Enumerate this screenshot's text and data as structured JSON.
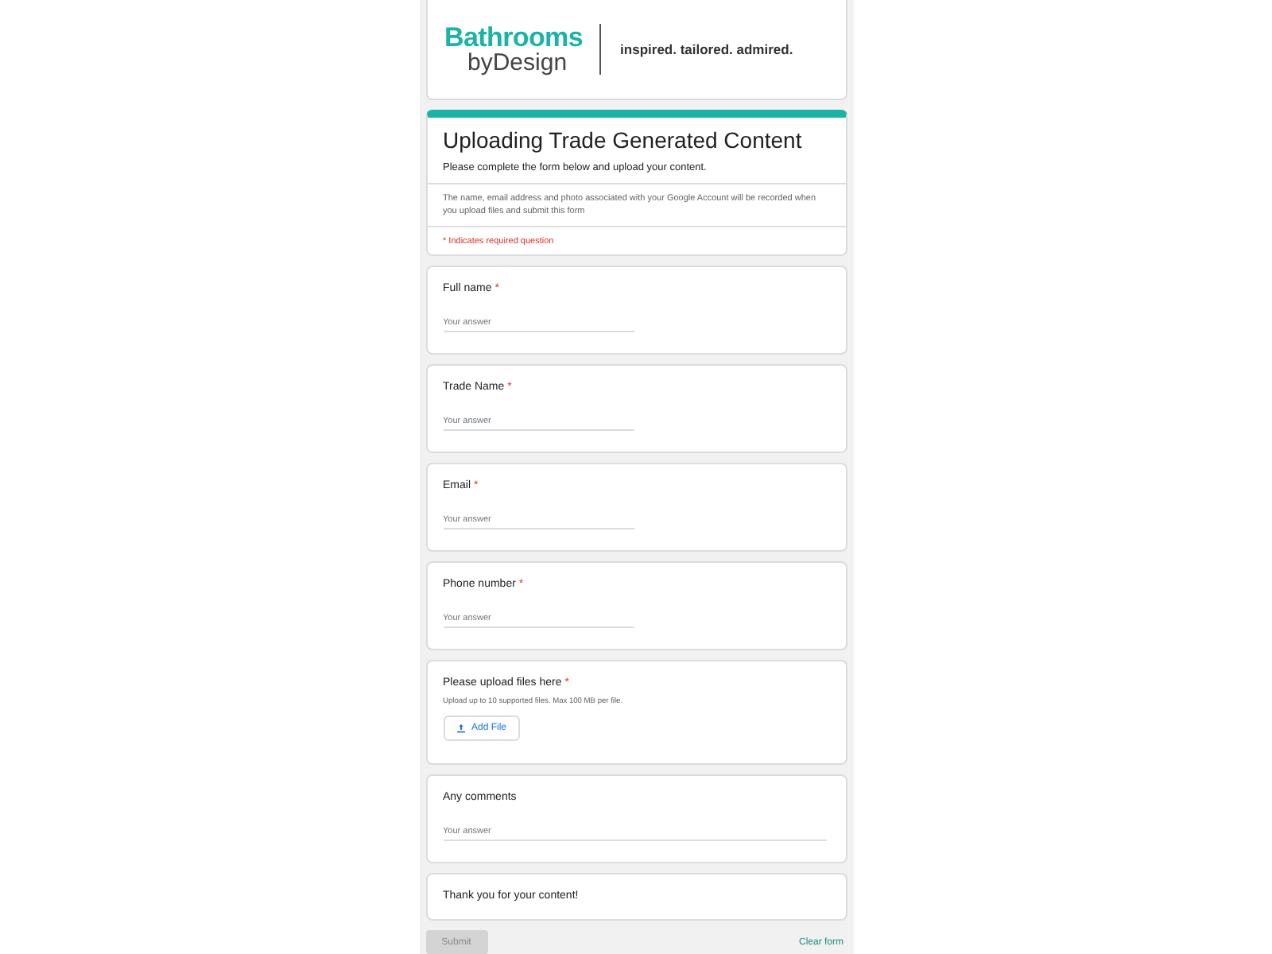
{
  "header": {
    "logo_top": "Bathrooms",
    "logo_bottom": "byDesign",
    "tagline": "inspired. tailored. admired."
  },
  "form": {
    "title": "Uploading Trade Generated Content",
    "description": "Please complete the form below and upload your content.",
    "notice": "The name, email address and photo associated with your Google Account will be recorded when you upload files and submit this form",
    "required_note": "* Indicates required question"
  },
  "questions": [
    {
      "kind": "short",
      "label": "Full name",
      "required_mark": "*",
      "placeholder": "Your answer"
    },
    {
      "kind": "short",
      "label": "Trade Name",
      "required_mark": "*",
      "placeholder": "Your answer"
    },
    {
      "kind": "short",
      "label": "Email",
      "required_mark": "*",
      "placeholder": "Your answer"
    },
    {
      "kind": "short",
      "label": "Phone number",
      "required_mark": "*",
      "placeholder": "Your answer"
    },
    {
      "kind": "file",
      "label": "Please upload files here",
      "required_mark": "*",
      "hint": "Upload up to 10 supported files. Max 100 MB per file.",
      "button": "Add File"
    },
    {
      "kind": "long",
      "label": "Any comments",
      "placeholder": "Your answer"
    },
    {
      "kind": "statement",
      "label": "Thank you for your content!"
    }
  ],
  "footer": {
    "submit": "Submit",
    "submit_disabled": true,
    "clear": "Clear form"
  }
}
